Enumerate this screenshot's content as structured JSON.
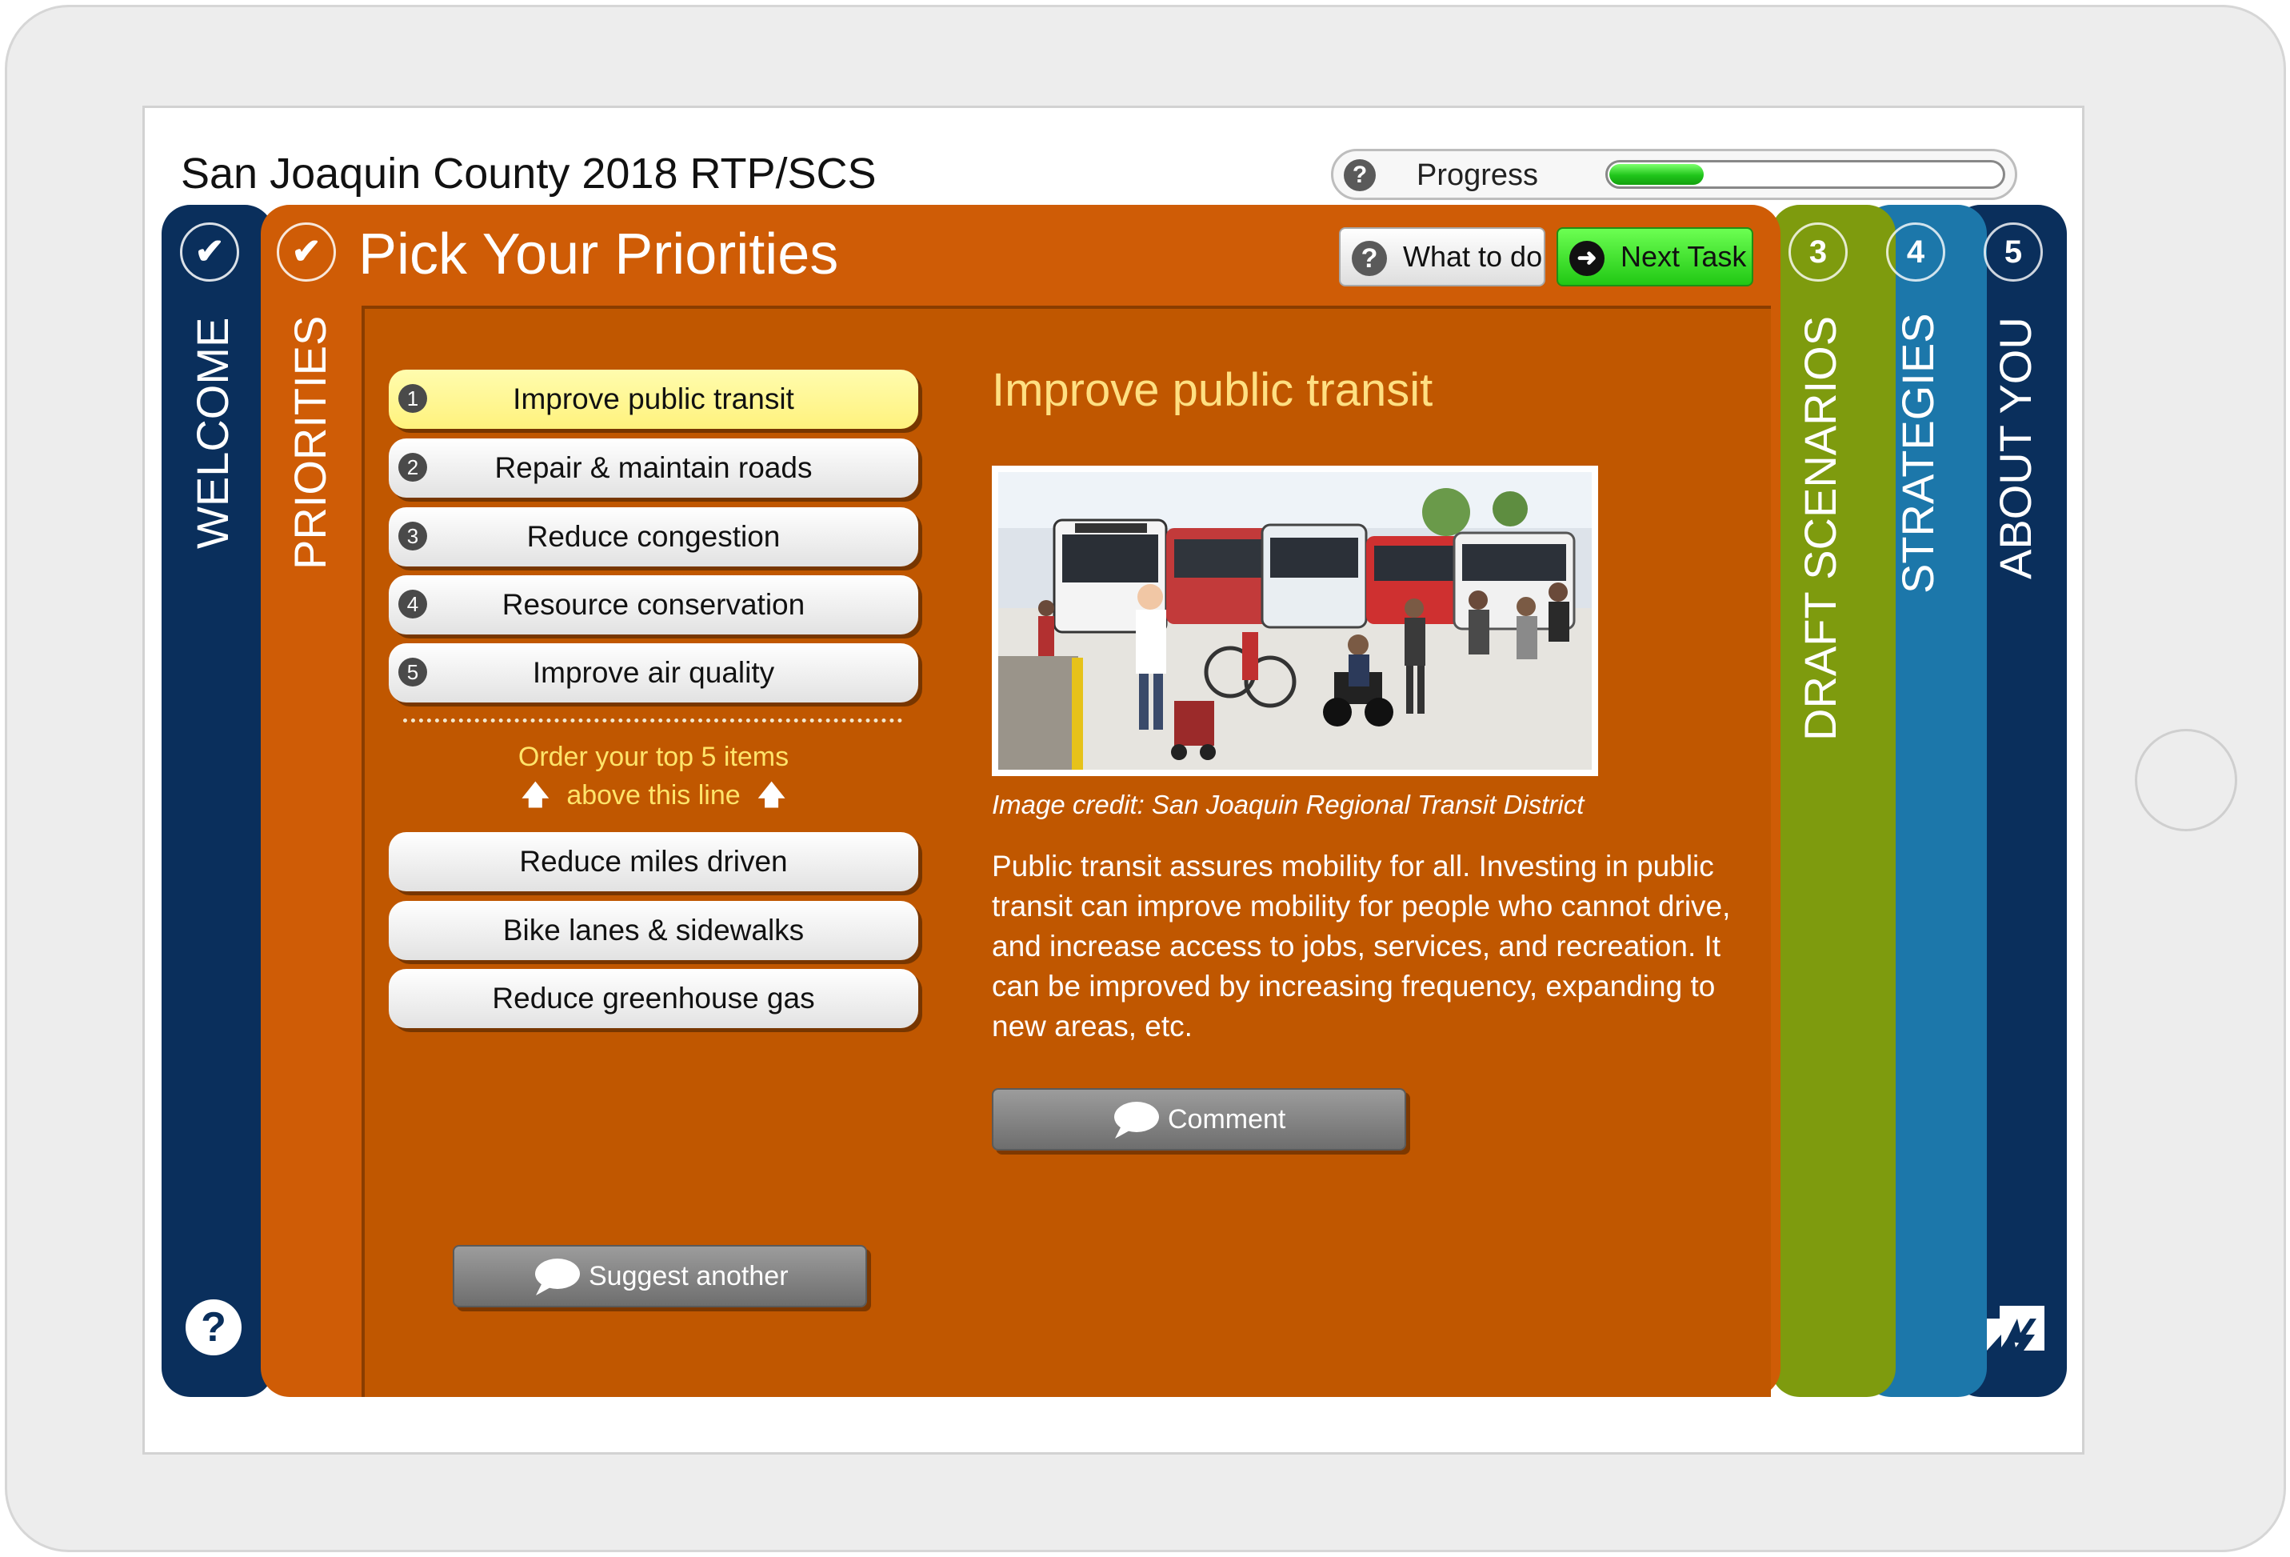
{
  "app": {
    "title": "San Joaquin County 2018 RTP/SCS"
  },
  "progress": {
    "label": "Progress",
    "value": 0.24
  },
  "nav": {
    "welcome": {
      "label": "WELCOME"
    },
    "priorities": {
      "label": "PRIORITIES"
    },
    "draft_scenarios": {
      "number": "3",
      "label": "DRAFT SCENARIOS"
    },
    "strategies": {
      "number": "4",
      "label": "STRATEGIES"
    },
    "about_you": {
      "number": "5",
      "label": "ABOUT YOU"
    }
  },
  "header": {
    "page_title": "Pick Your Priorities",
    "what_to_do_label": "What to do",
    "next_task_label": "Next Task"
  },
  "priorities": {
    "ranked": [
      {
        "rank": "1",
        "label": "Improve public transit"
      },
      {
        "rank": "2",
        "label": "Repair & maintain roads"
      },
      {
        "rank": "3",
        "label": "Reduce congestion"
      },
      {
        "rank": "4",
        "label": "Resource conservation"
      },
      {
        "rank": "5",
        "label": "Improve air quality"
      }
    ],
    "hint_line1": "Order your top 5 items",
    "hint_line2": "above this line",
    "unranked": [
      {
        "label": "Reduce miles driven"
      },
      {
        "label": "Bike lanes & sidewalks"
      },
      {
        "label": "Reduce greenhouse gas"
      }
    ],
    "suggest_label": "Suggest another"
  },
  "detail": {
    "title": "Improve public transit",
    "image_credit": "Image credit: San Joaquin Regional Transit District",
    "description": "Public transit assures mobility for all. Investing in public transit can improve mobility for people who cannot drive, and increase access to jobs, services, and recreation. It can be improved by increasing frequency, expanding to new areas, etc.",
    "comment_label": "Comment"
  },
  "colors": {
    "navy": "#0a2f5c",
    "orange": "#cf5c06",
    "olive": "#7e9b0e",
    "blue": "#1c77aa",
    "active_item": "#fff27d",
    "next_green": "#21c814"
  },
  "icons": {
    "help": "help-icon",
    "check": "check-icon",
    "next": "arrow-right-circle-icon",
    "comment": "speech-bubble-icon",
    "up": "arrow-up-icon",
    "logo": "mindmixer-logo-icon"
  }
}
